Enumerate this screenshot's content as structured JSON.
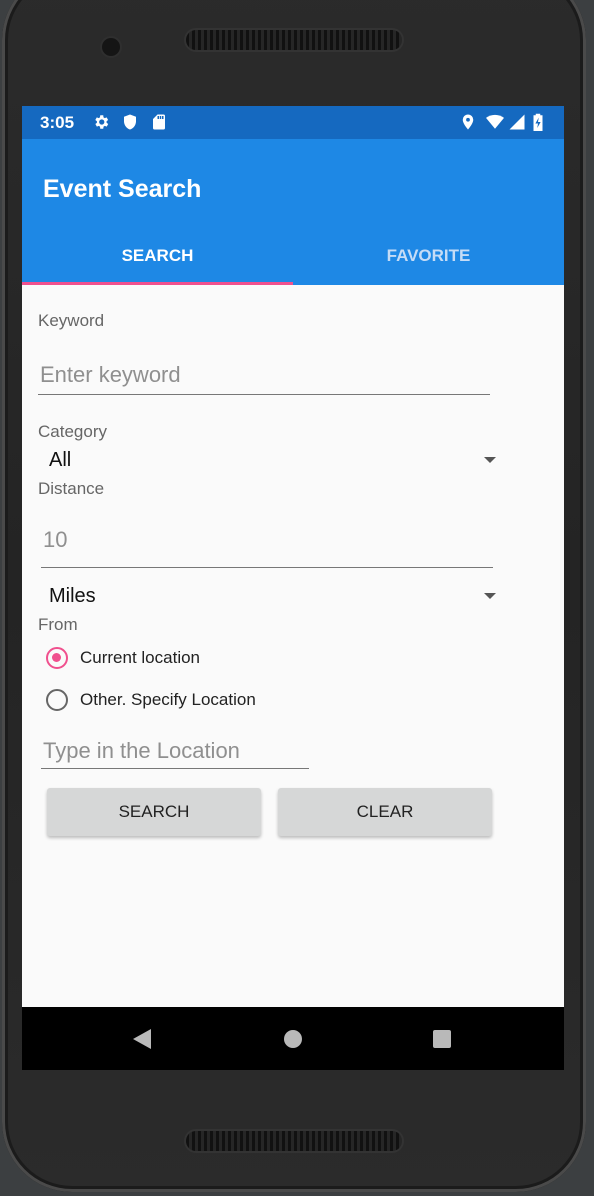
{
  "status_bar": {
    "time": "3:05"
  },
  "app": {
    "title": "Event Search"
  },
  "tabs": [
    {
      "label": "SEARCH",
      "selected": true
    },
    {
      "label": "FAVORITE",
      "selected": false
    }
  ],
  "form": {
    "keyword_label": "Keyword",
    "keyword_placeholder": "Enter keyword",
    "category_label": "Category",
    "category_value": "All",
    "distance_label": "Distance",
    "distance_placeholder": "10",
    "unit_value": "Miles",
    "from_label": "From",
    "radio_current": "Current location",
    "radio_other": "Other. Specify Location",
    "location_placeholder": "Type in the Location",
    "search_button": "SEARCH",
    "clear_button": "CLEAR"
  },
  "colors": {
    "status_bar": "#1569c0",
    "app_bar": "#1e88e5",
    "accent": "#f0508e"
  }
}
